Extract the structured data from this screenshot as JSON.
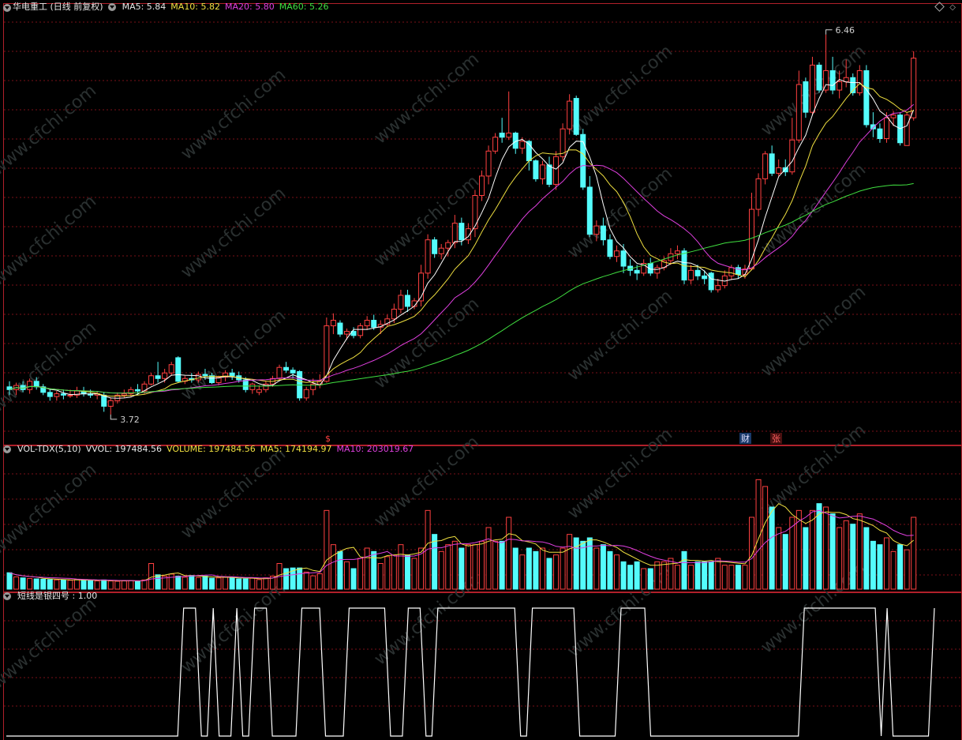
{
  "colors": {
    "up": "#ff4040",
    "down": "#54fcfc",
    "grid": "#7a1018",
    "ma5": "#ffffff",
    "ma10": "#f0e040",
    "ma20": "#e040e0",
    "ma60": "#40e040",
    "line": "#ffffff",
    "watermark": "#2a3030"
  },
  "price_legend": {
    "title": "华电重工 (日线 前复权)",
    "ma5": "MA5: 5.84",
    "ma10": "MA10: 5.82",
    "ma20": "MA20: 5.80",
    "ma60": "MA60: 5.26"
  },
  "vol_legend": {
    "title": "VOL-TDX(5,10)",
    "vvol": "VVOL: 197484.56",
    "volume": "VOLUME: 197484.56",
    "ma5": "MA5: 174194.97",
    "ma10": "MA10: 203019.67"
  },
  "ind_legend": {
    "title": "短线是银四号 : 1.00"
  },
  "annotations": {
    "high_label": "6.46",
    "low_label": "3.72",
    "marker_s": "$",
    "marker_cai": "财",
    "marker_zhang": "张"
  },
  "watermark": "www.cfchi.com",
  "chart_data": [
    {
      "type": "candlestick",
      "title": "华电重工 (日线 前复权)",
      "ylim": [
        3.6,
        6.55
      ],
      "ohlc": [
        [
          3.92,
          3.96,
          3.86,
          3.9
        ],
        [
          3.9,
          3.95,
          3.86,
          3.93
        ],
        [
          3.93,
          3.96,
          3.88,
          3.9
        ],
        [
          3.9,
          3.98,
          3.87,
          3.96
        ],
        [
          3.96,
          3.99,
          3.9,
          3.92
        ],
        [
          3.92,
          3.94,
          3.86,
          3.88
        ],
        [
          3.88,
          3.9,
          3.82,
          3.85
        ],
        [
          3.85,
          3.89,
          3.82,
          3.87
        ],
        [
          3.87,
          3.9,
          3.83,
          3.86
        ],
        [
          3.86,
          3.9,
          3.84,
          3.86
        ],
        [
          3.86,
          3.92,
          3.84,
          3.89
        ],
        [
          3.89,
          3.92,
          3.85,
          3.87
        ],
        [
          3.87,
          3.9,
          3.84,
          3.86
        ],
        [
          3.86,
          3.89,
          3.83,
          3.87
        ],
        [
          3.86,
          3.88,
          3.74,
          3.78
        ],
        [
          3.78,
          3.84,
          3.72,
          3.82
        ],
        [
          3.82,
          3.88,
          3.8,
          3.86
        ],
        [
          3.86,
          3.9,
          3.84,
          3.87
        ],
        [
          3.87,
          3.92,
          3.85,
          3.9
        ],
        [
          3.9,
          3.94,
          3.86,
          3.89
        ],
        [
          3.89,
          3.96,
          3.87,
          3.94
        ],
        [
          3.94,
          4.02,
          3.93,
          4.0
        ],
        [
          4.0,
          4.1,
          3.95,
          3.98
        ],
        [
          3.98,
          4.05,
          3.95,
          4.02
        ],
        [
          4.02,
          4.1,
          4.0,
          4.08
        ],
        [
          4.13,
          4.14,
          3.95,
          3.96
        ],
        [
          3.96,
          4.0,
          3.94,
          3.98
        ],
        [
          3.98,
          4.02,
          3.95,
          3.97
        ],
        [
          3.97,
          4.03,
          3.95,
          4.01
        ],
        [
          4.01,
          4.05,
          3.97,
          4.0
        ],
        [
          4.0,
          4.02,
          3.94,
          3.95
        ],
        [
          3.95,
          4.0,
          3.93,
          3.99
        ],
        [
          3.99,
          4.04,
          3.96,
          4.02
        ],
        [
          4.02,
          4.05,
          3.97,
          4.0
        ],
        [
          4.0,
          4.03,
          3.95,
          3.97
        ],
        [
          3.97,
          3.99,
          3.88,
          3.9
        ],
        [
          3.9,
          3.95,
          3.87,
          3.94
        ],
        [
          3.88,
          3.93,
          3.86,
          3.9
        ],
        [
          3.9,
          3.96,
          3.88,
          3.94
        ],
        [
          3.94,
          4.0,
          3.92,
          3.98
        ],
        [
          3.98,
          4.08,
          3.97,
          4.06
        ],
        [
          4.06,
          4.1,
          4.02,
          4.04
        ],
        [
          4.04,
          4.06,
          3.98,
          4.02
        ],
        [
          4.03,
          4.04,
          3.82,
          3.84
        ],
        [
          3.84,
          3.92,
          3.82,
          3.9
        ],
        [
          3.9,
          3.98,
          3.86,
          3.94
        ],
        [
          3.94,
          4.01,
          3.91,
          3.96
        ],
        [
          3.96,
          4.42,
          3.95,
          4.36
        ],
        [
          4.36,
          4.45,
          4.3,
          4.4
        ],
        [
          4.38,
          4.4,
          4.28,
          4.3
        ],
        [
          4.3,
          4.34,
          4.26,
          4.32
        ],
        [
          4.32,
          4.35,
          4.27,
          4.29
        ],
        [
          4.29,
          4.38,
          4.27,
          4.36
        ],
        [
          4.36,
          4.43,
          4.33,
          4.4
        ],
        [
          4.4,
          4.44,
          4.33,
          4.35
        ],
        [
          4.35,
          4.4,
          4.3,
          4.37
        ],
        [
          4.37,
          4.44,
          4.35,
          4.41
        ],
        [
          4.41,
          4.52,
          4.38,
          4.48
        ],
        [
          4.48,
          4.62,
          4.45,
          4.58
        ],
        [
          4.58,
          4.62,
          4.46,
          4.5
        ],
        [
          4.5,
          4.56,
          4.48,
          4.54
        ],
        [
          4.54,
          4.8,
          4.5,
          4.74
        ],
        [
          4.74,
          5.02,
          4.7,
          4.98
        ],
        [
          4.98,
          5.0,
          4.85,
          4.88
        ],
        [
          4.88,
          4.95,
          4.84,
          4.92
        ],
        [
          4.92,
          4.98,
          4.86,
          4.96
        ],
        [
          4.96,
          5.16,
          4.92,
          5.1
        ],
        [
          5.1,
          5.14,
          4.94,
          4.98
        ],
        [
          4.98,
          5.1,
          4.95,
          5.06
        ],
        [
          5.06,
          5.34,
          5.0,
          5.3
        ],
        [
          5.3,
          5.48,
          5.26,
          5.44
        ],
        [
          5.44,
          5.66,
          5.38,
          5.62
        ],
        [
          5.62,
          5.75,
          5.6,
          5.72
        ],
        [
          5.75,
          5.86,
          5.68,
          5.72
        ],
        [
          5.72,
          6.05,
          5.7,
          5.75
        ],
        [
          5.75,
          5.76,
          5.6,
          5.64
        ],
        [
          5.64,
          5.72,
          5.6,
          5.69
        ],
        [
          5.69,
          5.7,
          5.48,
          5.55
        ],
        [
          5.55,
          5.56,
          5.4,
          5.42
        ],
        [
          5.42,
          5.55,
          5.38,
          5.52
        ],
        [
          5.52,
          5.58,
          5.36,
          5.38
        ],
        [
          5.38,
          5.62,
          5.34,
          5.58
        ],
        [
          5.58,
          5.82,
          5.55,
          5.78
        ],
        [
          5.78,
          6.03,
          5.74,
          5.98
        ],
        [
          6.0,
          6.02,
          5.73,
          5.74
        ],
        [
          5.74,
          5.78,
          5.34,
          5.36
        ],
        [
          5.36,
          5.44,
          5.0,
          5.02
        ],
        [
          5.02,
          5.12,
          4.97,
          5.08
        ],
        [
          5.08,
          5.14,
          4.94,
          4.98
        ],
        [
          4.98,
          5.02,
          4.84,
          4.86
        ],
        [
          4.86,
          4.94,
          4.82,
          4.9
        ],
        [
          4.9,
          4.95,
          4.74,
          4.79
        ],
        [
          4.79,
          4.84,
          4.72,
          4.76
        ],
        [
          4.76,
          4.8,
          4.69,
          4.74
        ],
        [
          4.74,
          4.84,
          4.72,
          4.81
        ],
        [
          4.81,
          4.85,
          4.72,
          4.74
        ],
        [
          4.74,
          4.8,
          4.7,
          4.78
        ],
        [
          4.78,
          4.86,
          4.76,
          4.83
        ],
        [
          4.83,
          4.92,
          4.8,
          4.88
        ],
        [
          4.88,
          4.94,
          4.84,
          4.9
        ],
        [
          4.9,
          4.92,
          4.66,
          4.69
        ],
        [
          4.69,
          4.8,
          4.66,
          4.76
        ],
        [
          4.76,
          4.8,
          4.69,
          4.72
        ],
        [
          4.72,
          4.76,
          4.66,
          4.7
        ],
        [
          4.74,
          4.75,
          4.6,
          4.62
        ],
        [
          4.62,
          4.7,
          4.6,
          4.65
        ],
        [
          4.65,
          4.76,
          4.63,
          4.72
        ],
        [
          4.72,
          4.8,
          4.69,
          4.78
        ],
        [
          4.78,
          4.8,
          4.7,
          4.73
        ],
        [
          4.73,
          4.8,
          4.7,
          4.77
        ],
        [
          4.77,
          5.32,
          4.76,
          5.2
        ],
        [
          5.2,
          5.46,
          5.15,
          5.42
        ],
        [
          5.42,
          5.62,
          5.38,
          5.6
        ],
        [
          5.6,
          5.66,
          5.44,
          5.46
        ],
        [
          5.46,
          5.56,
          5.44,
          5.5
        ],
        [
          5.5,
          5.56,
          5.44,
          5.47
        ],
        [
          5.47,
          5.86,
          5.45,
          5.7
        ],
        [
          5.7,
          6.2,
          5.68,
          6.1
        ],
        [
          6.12,
          6.15,
          5.86,
          5.9
        ],
        [
          5.9,
          6.3,
          5.88,
          6.24
        ],
        [
          6.24,
          6.26,
          6.04,
          6.06
        ],
        [
          6.06,
          6.46,
          6.04,
          6.2
        ],
        [
          6.2,
          6.3,
          6.03,
          6.06
        ],
        [
          6.06,
          6.2,
          6.0,
          6.12
        ],
        [
          6.12,
          6.28,
          6.08,
          6.15
        ],
        [
          6.15,
          6.18,
          6.02,
          6.04
        ],
        [
          6.04,
          6.24,
          6.02,
          6.2
        ],
        [
          6.2,
          6.24,
          5.79,
          5.81
        ],
        [
          5.81,
          5.9,
          5.72,
          5.78
        ],
        [
          5.78,
          5.82,
          5.68,
          5.71
        ],
        [
          5.71,
          5.9,
          5.68,
          5.86
        ],
        [
          5.86,
          5.91,
          5.8,
          5.88
        ],
        [
          5.88,
          5.9,
          5.66,
          5.68
        ],
        [
          5.66,
          5.9,
          5.66,
          5.88
        ],
        [
          5.86,
          6.34,
          5.84,
          6.29
        ]
      ],
      "series": [
        {
          "name": "MA5",
          "value": 5.84
        },
        {
          "name": "MA10",
          "value": 5.82
        },
        {
          "name": "MA20",
          "value": 5.8
        },
        {
          "name": "MA60",
          "value": 5.26
        }
      ],
      "annotations": [
        {
          "text": "6.46",
          "y": 6.46
        },
        {
          "text": "3.72",
          "y": 3.72
        }
      ]
    },
    {
      "type": "bar",
      "title": "VOL-TDX(5,10)",
      "ylim": [
        0,
        360000
      ],
      "values": [
        48000,
        36000,
        33000,
        31000,
        30000,
        29000,
        28000,
        27000,
        27000,
        26000,
        28000,
        26000,
        25000,
        24000,
        27000,
        24000,
        23000,
        24000,
        25000,
        24000,
        27000,
        75000,
        42000,
        38000,
        44000,
        38000,
        35000,
        40000,
        34000,
        38000,
        32000,
        33000,
        36000,
        34000,
        30000,
        30000,
        32000,
        28000,
        33000,
        38000,
        75000,
        60000,
        62000,
        62000,
        50000,
        39000,
        45000,
        230000,
        130000,
        110000,
        80000,
        60000,
        90000,
        120000,
        110000,
        75000,
        95000,
        100000,
        130000,
        100000,
        90000,
        120000,
        230000,
        160000,
        110000,
        130000,
        140000,
        120000,
        130000,
        130000,
        140000,
        180000,
        140000,
        140000,
        210000,
        120000,
        100000,
        120000,
        110000,
        120000,
        90000,
        100000,
        120000,
        160000,
        150000,
        140000,
        150000,
        120000,
        130000,
        110000,
        100000,
        80000,
        70000,
        80000,
        60000,
        60000,
        80000,
        80000,
        90000,
        70000,
        110000,
        70000,
        80000,
        80000,
        80000,
        90000,
        70000,
        70000,
        70000,
        70000,
        210000,
        320000,
        300000,
        240000,
        180000,
        160000,
        210000,
        230000,
        180000,
        230000,
        250000,
        240000,
        220000,
        180000,
        200000,
        190000,
        220000,
        180000,
        140000,
        130000,
        150000,
        110000,
        130000,
        115000,
        210000
      ],
      "series": [
        {
          "name": "VOLUME",
          "value": 197484.56
        },
        {
          "name": "MA5",
          "value": 174194.97
        },
        {
          "name": "MA10",
          "value": 203019.67
        }
      ]
    },
    {
      "type": "line",
      "title": "短线是银四号",
      "ylim": [
        0,
        1
      ],
      "values": [
        0,
        0,
        0,
        0,
        0,
        0,
        0,
        0,
        0,
        0,
        0,
        0,
        0,
        0,
        0,
        0,
        0,
        0,
        0,
        0,
        0,
        0,
        0,
        0,
        0,
        0,
        0,
        0,
        0,
        0,
        1,
        1,
        1,
        0,
        0,
        1,
        0,
        0,
        0,
        1,
        0,
        0,
        1,
        1,
        1,
        0,
        0,
        0,
        0,
        0,
        1,
        1,
        1,
        1,
        0,
        0,
        0,
        0,
        1,
        1,
        1,
        1,
        1,
        1,
        1,
        0,
        0,
        0,
        1,
        1,
        1,
        0,
        0,
        1,
        1,
        1,
        1,
        1,
        1,
        1,
        1,
        1,
        1,
        1,
        1,
        1,
        1,
        0,
        0,
        1,
        1,
        1,
        1,
        1,
        1,
        1,
        1,
        0,
        0,
        0,
        0,
        0,
        0,
        0,
        1,
        1,
        1,
        1,
        1,
        0,
        0,
        0,
        0,
        0,
        0,
        0,
        0,
        0,
        0,
        0,
        0,
        0,
        0,
        0,
        0,
        0,
        0,
        0,
        0,
        0,
        0,
        0,
        0,
        0,
        0,
        1,
        1,
        1,
        1,
        1,
        1,
        1,
        1,
        1,
        1,
        1,
        1,
        1,
        0,
        1,
        0,
        0,
        0,
        0,
        0,
        0,
        0,
        1
      ],
      "series": [
        {
          "name": "短线是银四号",
          "value": 1.0
        }
      ]
    }
  ]
}
